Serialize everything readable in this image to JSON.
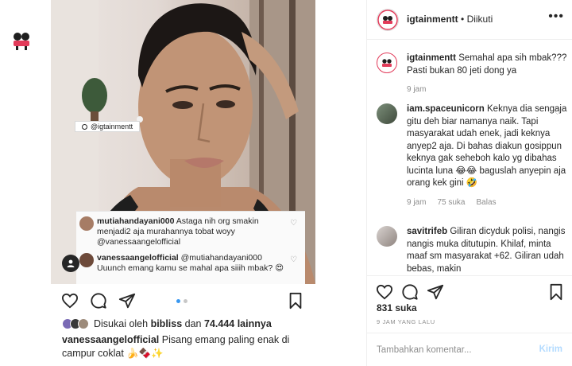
{
  "post": {
    "username": "igtainmentt",
    "follow_separator": "•",
    "follow_status": "Diikuti",
    "more": "•••"
  },
  "photo": {
    "tag_label": "@igtainmentt",
    "overlay_comments": [
      {
        "user": "mutiahandayani000",
        "text": "Astaga nih org smakin menjadi2 aja murahannya tobat woyy @vanessaangelofficial"
      },
      {
        "user": "vanessaangelofficial",
        "text": "@mutiahandayani000 Uuunch emang kamu se mahal apa siiih mbak? 😍"
      }
    ]
  },
  "left_footer": {
    "likes_prefix": "Disukai oleh",
    "likes_user": "bibliss",
    "likes_mid": "dan",
    "likes_count": "74.444 lainnya",
    "caption_user": "vanessaangelofficial",
    "caption_text": "Pisang emang paling enak di campur coklat 🍌🍫✨"
  },
  "comments": [
    {
      "user": "igtainmentt",
      "text": "Semahal apa sih mbak??? Pasti bukan 80 jeti dong ya",
      "time": "9 jam",
      "likes": "",
      "reply": ""
    },
    {
      "user": "iam.spaceunicorn",
      "text": "Keknya dia sengaja gitu deh biar namanya naik. Tapi masyarakat udah enek, jadi keknya anyep2 aja. Di bahas diakun gosippun keknya gak seheboh kalo yg dibahas lucinta luna 😂😂 baguslah anyepin aja orang kek gini 🤣",
      "time": "9 jam",
      "likes": "75 suka",
      "reply": "Balas"
    },
    {
      "user": "savitrifeb",
      "text": "Giliran dicyduk polisi, nangis nangis muka ditutupin. Khilaf, minta maaf sm masyarakat +62. Giliran udah bebas, makin",
      "time": "",
      "likes": "",
      "reply": ""
    }
  ],
  "panel_footer": {
    "likes": "831 suka",
    "time_ago": "9 JAM YANG LALU",
    "comment_placeholder": "Tambahkan komentar...",
    "send_label": "Kirim"
  },
  "colors": {
    "accent": "#3897f0",
    "send_disabled": "#b3dbff",
    "muted": "#8e8e8e",
    "text": "#262626"
  },
  "icons": [
    "heart-icon",
    "comment-icon",
    "share-icon",
    "bookmark-icon",
    "person-tag-icon",
    "more-icon"
  ]
}
